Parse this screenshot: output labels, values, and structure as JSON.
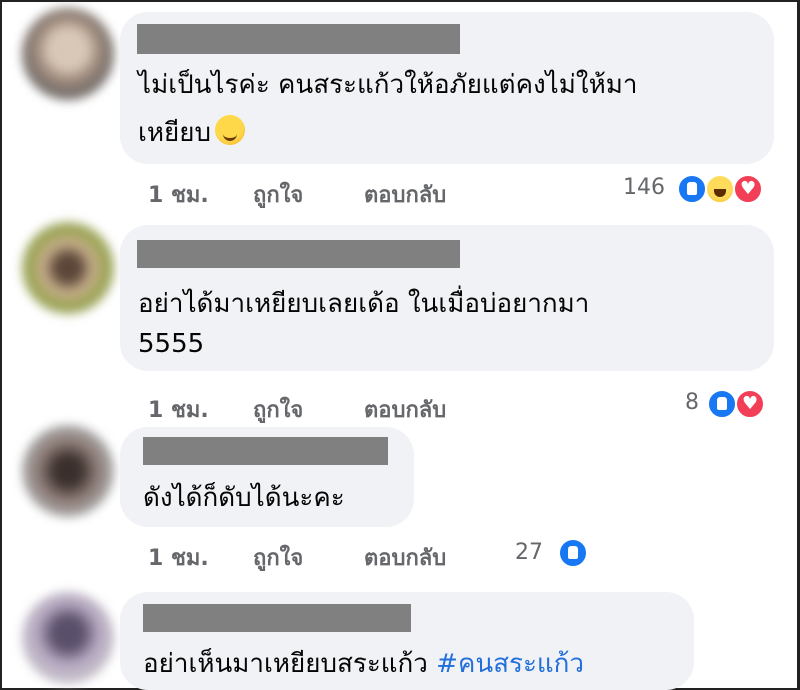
{
  "comments": [
    {
      "lines": [
        "ไม่เป็นไรค่ะ คนสระแก้วให้อภัยแต่คงไม่ให้มา",
        "เหยียบ"
      ],
      "emoji": "smirking-face",
      "time": "1 ชม.",
      "like_label": "ถูกใจ",
      "reply_label": "ตอบกลับ",
      "reaction_count": "146",
      "reactions": [
        "like",
        "haha",
        "love"
      ]
    },
    {
      "lines": [
        "อย่าได้มาเหยียบเลยเด้อ ในเมื่อบ่อยากมา",
        "5555"
      ],
      "time": "1 ชม.",
      "like_label": "ถูกใจ",
      "reply_label": "ตอบกลับ",
      "reaction_count": "8",
      "reactions": [
        "like",
        "love"
      ]
    },
    {
      "lines": [
        "ดังได้ก็ดับได้นะคะ"
      ],
      "time": "1 ชม.",
      "like_label": "ถูกใจ",
      "reply_label": "ตอบกลับ",
      "reaction_count": "27",
      "reactions": [
        "like"
      ]
    },
    {
      "lines": [
        "อย่าเห็นมาเหยียบสระแก้ว "
      ],
      "hashtag": "#คนสระแก้ว"
    }
  ],
  "colors": {
    "bubble": "#f0f2f5",
    "meta_text": "#65676b",
    "hashtag": "#216fdb",
    "like": "#1877f2",
    "love": "#f33e58"
  }
}
